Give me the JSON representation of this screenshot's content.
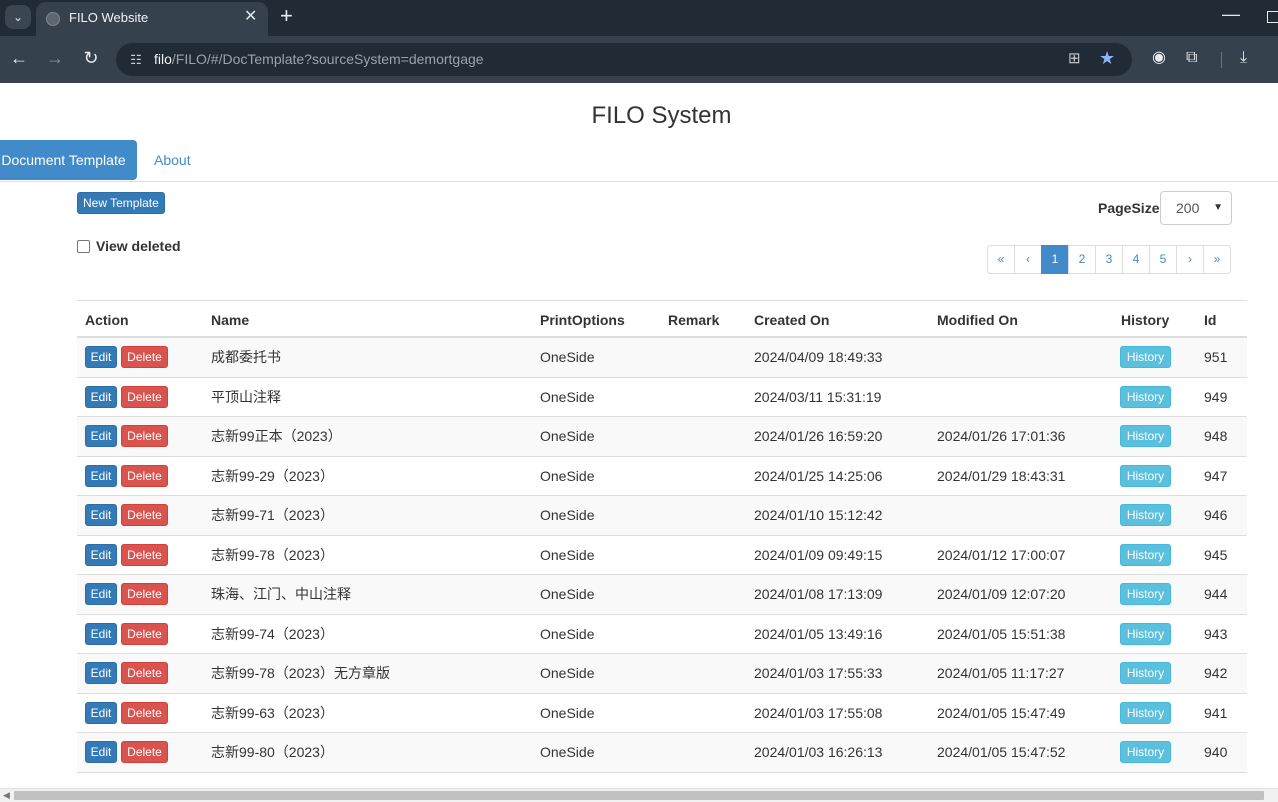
{
  "browser": {
    "tab_title": "FILO Website",
    "tab_close": "✕",
    "new_tab": "+",
    "url_host": "filo",
    "url_path": "/FILO/#/DocTemplate?sourceSystem=demortgage"
  },
  "page": {
    "title": "FILO System"
  },
  "nav": {
    "active_tab": "Document Template",
    "about": "About"
  },
  "toolbar": {
    "new_template": "New Template",
    "page_size_label": "PageSize",
    "page_size_value": "200",
    "view_deleted_label": "View deleted",
    "view_deleted_checked": false
  },
  "pagination": {
    "first": "«",
    "prev": "‹",
    "pages": [
      "1",
      "2",
      "3",
      "4",
      "5"
    ],
    "active": "1",
    "next": "›",
    "last": "»"
  },
  "table": {
    "headers": {
      "action": "Action",
      "name": "Name",
      "print_options": "PrintOptions",
      "remark": "Remark",
      "created_on": "Created On",
      "modified_on": "Modified On",
      "history": "History",
      "id": "Id"
    },
    "edit_label": "Edit",
    "delete_label": "Delete",
    "history_label": "History",
    "rows": [
      {
        "name": "成都委托书",
        "print_options": "OneSide",
        "remark": "",
        "created_on": "2024/04/09 18:49:33",
        "modified_on": "",
        "id": "951"
      },
      {
        "name": "平顶山注释",
        "print_options": "OneSide",
        "remark": "",
        "created_on": "2024/03/11 15:31:19",
        "modified_on": "",
        "id": "949"
      },
      {
        "name": "志新99正本（2023）",
        "print_options": "OneSide",
        "remark": "",
        "created_on": "2024/01/26 16:59:20",
        "modified_on": "2024/01/26 17:01:36",
        "id": "948"
      },
      {
        "name": "志新99-29（2023）",
        "print_options": "OneSide",
        "remark": "",
        "created_on": "2024/01/25 14:25:06",
        "modified_on": "2024/01/29 18:43:31",
        "id": "947"
      },
      {
        "name": "志新99-71（2023）",
        "print_options": "OneSide",
        "remark": "",
        "created_on": "2024/01/10 15:12:42",
        "modified_on": "",
        "id": "946"
      },
      {
        "name": "志新99-78（2023）",
        "print_options": "OneSide",
        "remark": "",
        "created_on": "2024/01/09 09:49:15",
        "modified_on": "2024/01/12 17:00:07",
        "id": "945"
      },
      {
        "name": "珠海、江门、中山注释",
        "print_options": "OneSide",
        "remark": "",
        "created_on": "2024/01/08 17:13:09",
        "modified_on": "2024/01/09 12:07:20",
        "id": "944"
      },
      {
        "name": "志新99-74（2023）",
        "print_options": "OneSide",
        "remark": "",
        "created_on": "2024/01/05 13:49:16",
        "modified_on": "2024/01/05 15:51:38",
        "id": "943"
      },
      {
        "name": "志新99-78（2023）无方章版",
        "print_options": "OneSide",
        "remark": "",
        "created_on": "2024/01/03 17:55:33",
        "modified_on": "2024/01/05 11:17:27",
        "id": "942"
      },
      {
        "name": "志新99-63（2023）",
        "print_options": "OneSide",
        "remark": "",
        "created_on": "2024/01/03 17:55:08",
        "modified_on": "2024/01/05 15:47:49",
        "id": "941"
      },
      {
        "name": "志新99-80（2023）",
        "print_options": "OneSide",
        "remark": "",
        "created_on": "2024/01/03 16:26:13",
        "modified_on": "2024/01/05 15:47:52",
        "id": "940"
      }
    ]
  }
}
